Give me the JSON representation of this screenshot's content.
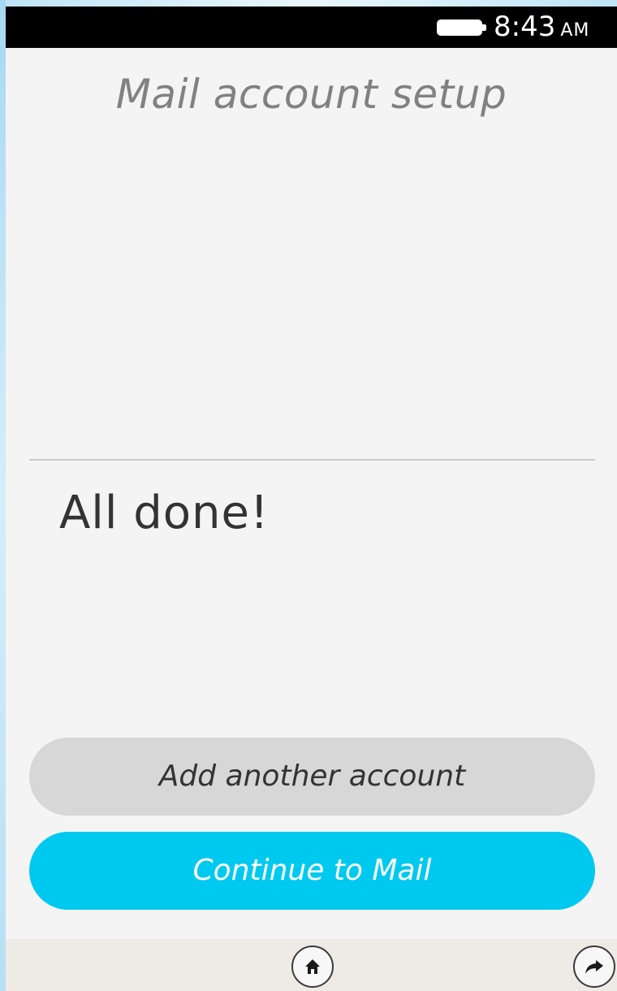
{
  "status_bar": {
    "time": "8:43",
    "ampm": "AM",
    "battery_icon": "battery-full-icon"
  },
  "screen": {
    "title": "Mail account setup",
    "message": "All done!"
  },
  "actions": {
    "add_account_label": "Add another account",
    "continue_label": "Continue to Mail"
  },
  "nav_bar": {
    "home_icon": "home-icon",
    "share_icon": "share-arrow-icon"
  },
  "colors": {
    "accent": "#00c9f0",
    "secondary_button": "#d7d7d7",
    "background": "#f4f4f4",
    "status_bar": "#000000"
  }
}
